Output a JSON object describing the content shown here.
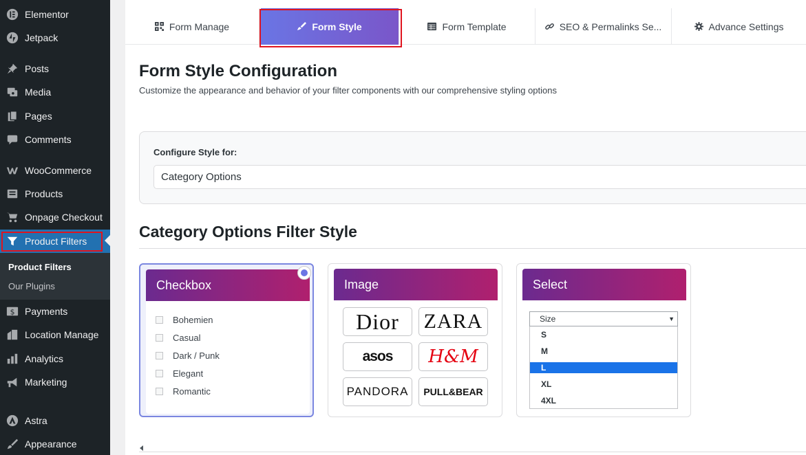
{
  "sidebar": {
    "items": [
      {
        "label": "Elementor",
        "icon": "elementor-icon"
      },
      {
        "label": "Jetpack",
        "icon": "jetpack-icon"
      },
      {
        "label": "Posts",
        "icon": "pin-icon"
      },
      {
        "label": "Media",
        "icon": "media-icon"
      },
      {
        "label": "Pages",
        "icon": "pages-icon"
      },
      {
        "label": "Comments",
        "icon": "comment-icon"
      },
      {
        "label": "WooCommerce",
        "icon": "woocommerce-icon"
      },
      {
        "label": "Products",
        "icon": "archive-icon"
      },
      {
        "label": "Onpage Checkout",
        "icon": "cart-icon"
      },
      {
        "label": "Product Filters",
        "icon": "funnel-icon"
      },
      {
        "label": "Payments",
        "icon": "dollar-icon"
      },
      {
        "label": "Location Manage",
        "icon": "building-icon"
      },
      {
        "label": "Analytics",
        "icon": "bar-chart-icon"
      },
      {
        "label": "Marketing",
        "icon": "megaphone-icon"
      },
      {
        "label": "Astra",
        "icon": "astra-icon"
      },
      {
        "label": "Appearance",
        "icon": "paintbrush-icon"
      }
    ],
    "submenu": [
      {
        "label": "Product Filters"
      },
      {
        "label": "Our Plugins"
      }
    ]
  },
  "tabs": [
    {
      "label": "Form Manage",
      "icon": "qr-icon"
    },
    {
      "label": "Form Style",
      "icon": "brush-icon"
    },
    {
      "label": "Form Template",
      "icon": "table-icon"
    },
    {
      "label": "SEO & Permalinks Se...",
      "icon": "link-icon"
    },
    {
      "label": "Advance Settings",
      "icon": "gear-icon"
    }
  ],
  "page": {
    "title": "Form Style Configuration",
    "subtitle": "Customize the appearance and behavior of your filter components with our comprehensive styling options"
  },
  "config": {
    "label": "Configure Style for:",
    "value": "Category Options"
  },
  "section": {
    "title": "Category Options Filter Style"
  },
  "cards": {
    "checkbox": {
      "title": "Checkbox",
      "options": [
        "Bohemien",
        "Casual",
        "Dark / Punk",
        "Elegant",
        "Romantic"
      ]
    },
    "image": {
      "title": "Image",
      "logos": [
        "Dior",
        "ZARA",
        "asos",
        "H&M",
        "PANDORA",
        "PULL&BEAR"
      ]
    },
    "select": {
      "title": "Select",
      "placeholder": "Size",
      "options": [
        "S",
        "M",
        "L",
        "XL",
        "4XL"
      ],
      "selected": "L"
    }
  },
  "colors": {
    "sidebar_bg": "#1d2327",
    "active_menu": "#2271b1",
    "tab_gradient_start": "#6a75e4",
    "tab_gradient_end": "#7a56c9",
    "card_header_start": "#6b2a8f",
    "card_header_end": "#b0206e",
    "highlight": "#e0141e"
  }
}
